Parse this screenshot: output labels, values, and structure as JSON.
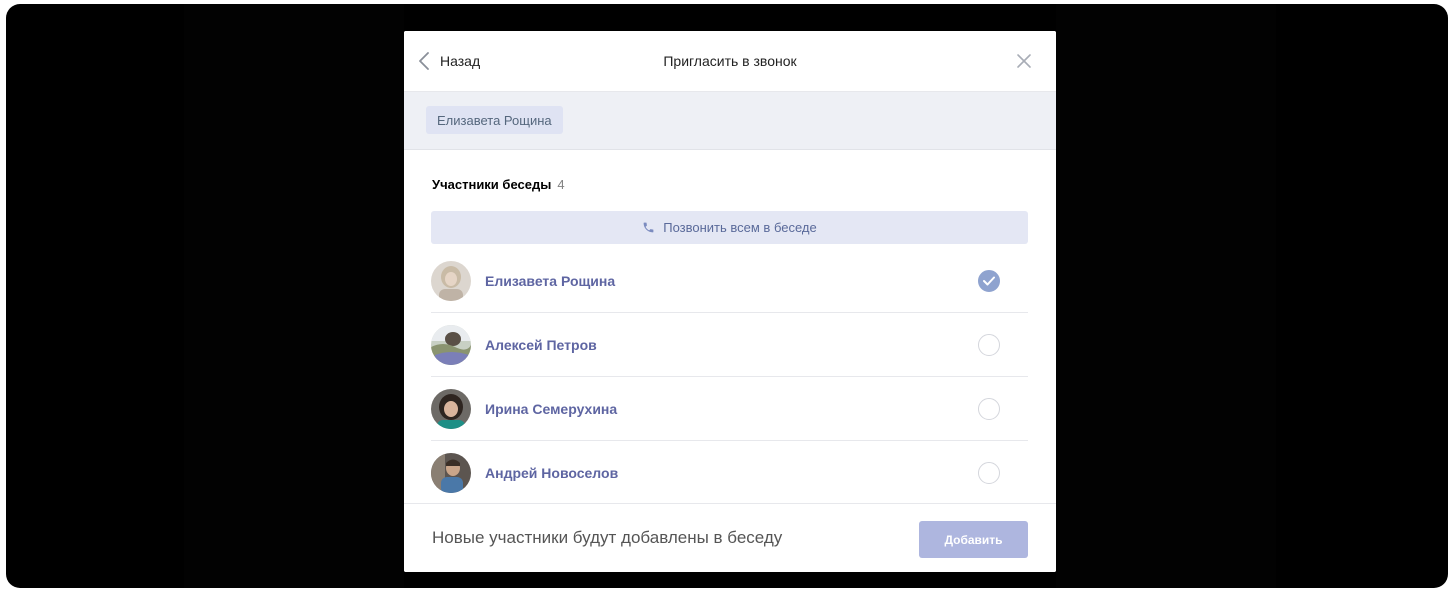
{
  "dialog": {
    "back_label": "Назад",
    "title": "Пригласить в звонок"
  },
  "selected": {
    "chips": [
      "Елизавета Рощина"
    ]
  },
  "members_section": {
    "title": "Участники беседы",
    "count": "4",
    "call_all_label": "Позвонить всем в беседе"
  },
  "members": [
    {
      "name": "Елизавета Рощина",
      "checked": true,
      "avatar": "avatar-photo-blonde-woman"
    },
    {
      "name": "Алексей Петров",
      "checked": false,
      "avatar": "avatar-photo-landscape"
    },
    {
      "name": "Ирина Семерухина",
      "checked": false,
      "avatar": "avatar-photo-woman-dark-hair"
    },
    {
      "name": "Андрей Новоселов",
      "checked": false,
      "avatar": "avatar-photo-man"
    }
  ],
  "footer": {
    "note": "Новые участники будут добавлены в беседу",
    "add_label": "Добавить"
  },
  "colors": {
    "accent": "#5e65a2",
    "selected_bar": "#eef0f5",
    "chip": "#dfe3f3",
    "call_all_bg": "#e4e7f4",
    "checked_radio": "#8fa3cf",
    "add_button_disabled": "#aeb6df",
    "backdrop": "#000000"
  },
  "icons": {
    "back": "chevron-left-icon",
    "close": "close-icon",
    "call": "phone-icon",
    "check": "checkmark-icon"
  }
}
